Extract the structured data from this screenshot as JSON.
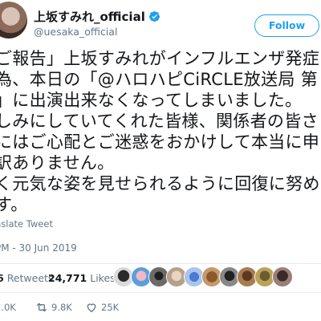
{
  "user": {
    "display_name": "上坂すみれ_official",
    "handle": "@uesaka_official",
    "verified_icon": "verified-badge-icon",
    "accent_color": "#1da1f2"
  },
  "follow_label": "Follow",
  "tweet": {
    "lines": [
      "ご報告」上坂すみれがインフルエンザ発症",
      "為、本日の「@ハロハピCiRCLE放送局 第",
      "」に出演出来なくなってしまいました。",
      "しみにしていてくれた皆様、関係者の皆さ",
      "にはご心配とご迷惑をおかけして本当に申",
      "訳ありません。",
      "く元気な姿を見せられるように回復に努め",
      "す。"
    ],
    "translate_label": "nslate Tweet",
    "timestamp": "PM - 30 Jun 2019"
  },
  "stats": {
    "retweets_count": "6",
    "retweets_label": "Retweets",
    "likes_count": "24,771",
    "likes_label": "Likes"
  },
  "actions": {
    "reply_count": "1.0K",
    "retweet_count": "9.8K",
    "like_count": "25K"
  }
}
